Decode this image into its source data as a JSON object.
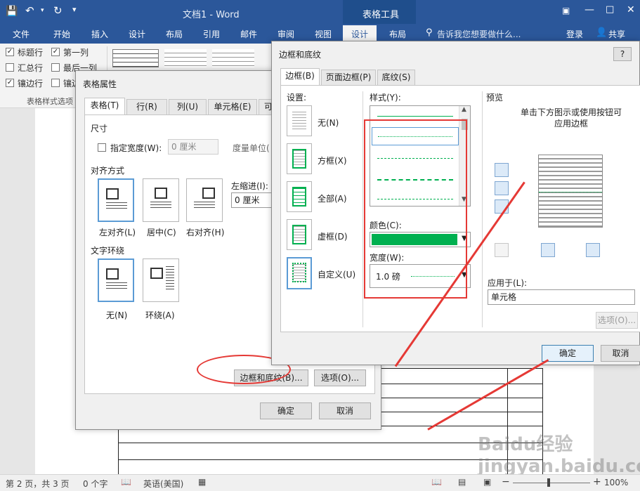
{
  "app": {
    "title": "文档1 - Word",
    "contextual_tab": "表格工具",
    "ribbon_tabs": [
      "文件",
      "开始",
      "插入",
      "设计",
      "布局",
      "引用",
      "邮件",
      "审阅",
      "视图",
      "设计",
      "布局"
    ],
    "tell_me": "告诉我您想要做什么...",
    "login": "登录",
    "share": "共享"
  },
  "ribbon": {
    "options": [
      {
        "label": "标题行",
        "checked": true
      },
      {
        "label": "第一列",
        "checked": true
      },
      {
        "label": "汇总行",
        "checked": false
      },
      {
        "label": "最后一列",
        "checked": false
      },
      {
        "label": "镶边行",
        "checked": true
      },
      {
        "label": "镶边",
        "checked": false
      }
    ],
    "group_label": "表格样式选项"
  },
  "table_props": {
    "title": "表格属性",
    "tabs": [
      "表格(T)",
      "行(R)",
      "列(U)",
      "单元格(E)",
      "可选"
    ],
    "size_label": "尺寸",
    "specify_width": "指定宽度(W):",
    "width_value": "0 厘米",
    "measure_unit": "度量单位(",
    "align_label": "对齐方式",
    "align_options": [
      "左对齐(L)",
      "居中(C)",
      "右对齐(H)"
    ],
    "indent_label": "左缩进(I):",
    "indent_value": "0 厘米",
    "wrap_label": "文字环绕",
    "wrap_options": [
      "无(N)",
      "环绕(A)"
    ],
    "borders_button": "边框和底纹(B)...",
    "options_button": "选项(O)...",
    "ok": "确定",
    "cancel": "取消"
  },
  "borders": {
    "title": "边框和底纹",
    "help": "?",
    "tabs": [
      "边框(B)",
      "页面边框(P)",
      "底纹(S)"
    ],
    "settings_label": "设置:",
    "settings": [
      "无(N)",
      "方框(X)",
      "全部(A)",
      "虚框(D)",
      "自定义(U)"
    ],
    "style_label": "样式(Y):",
    "color_label": "颜色(C):",
    "color_value": "#00b050",
    "width_label": "宽度(W):",
    "width_value": "1.0 磅",
    "preview_label": "预览",
    "preview_hint": "单击下方图示或使用按钮可应用边框",
    "apply_label": "应用于(L):",
    "apply_value": "单元格",
    "options_button": "选项(O)...",
    "ok": "确定",
    "cancel": "取消"
  },
  "status": {
    "page": "第 2 页，共 3 页",
    "words": "0 个字",
    "language": "英语(美国)",
    "zoom": "100%"
  },
  "colors": {
    "accent": "#2b579a",
    "highlight": "#e53935",
    "line_green": "#00b050"
  },
  "watermark": "Baidu经验 jingyan.baidu.com"
}
